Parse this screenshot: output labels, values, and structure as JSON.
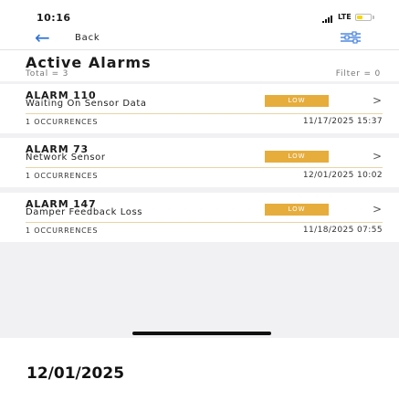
{
  "status": {
    "time": "10:16",
    "network": "LTE"
  },
  "nav": {
    "back_label": "Back"
  },
  "header": {
    "title": "Active Alarms",
    "total": "Total = 3",
    "filter": "Filter = 0"
  },
  "alarms": [
    {
      "name": "ALARM 110",
      "description": "Waiting On Sensor Data",
      "severity": "LOW",
      "occurrences": "1 OCCURRENCES",
      "timestamp": "11/17/2025 15:37"
    },
    {
      "name": "ALARM 73",
      "description": "Network Sensor",
      "severity": "LOW",
      "occurrences": "1 OCCURRENCES",
      "timestamp": "12/01/2025 10:02"
    },
    {
      "name": "ALARM 147",
      "description": "Damper Feedback Loss",
      "severity": "LOW",
      "occurrences": "1 OCCURRENCES",
      "timestamp": "11/18/2025 07:55"
    }
  ],
  "caption": "12/01/2025",
  "colors": {
    "accent": "#2f73d9",
    "severity_low": "#e6ad3c",
    "divider": "#e7d3a6",
    "battery": "#f5d80c"
  }
}
